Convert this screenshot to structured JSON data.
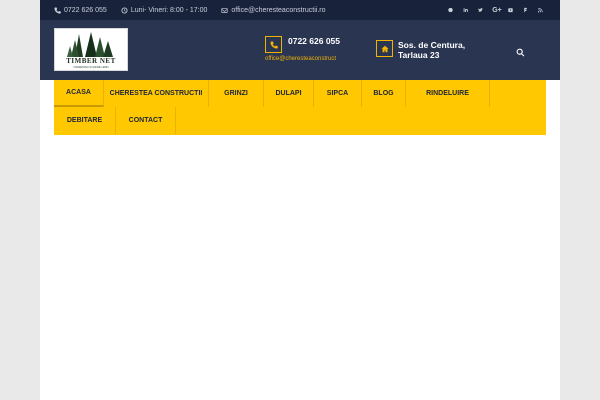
{
  "topbar": {
    "phone": "0722 626 055",
    "hours": "Luni- Vineri: 8:00 - 17:00",
    "email": "office@cheresteaconstructii.ro",
    "social_icons": [
      "facebook-icon",
      "linkedin-icon",
      "twitter-icon",
      "google-plus-icon",
      "youtube-icon",
      "foursquare-icon",
      "rss-icon"
    ]
  },
  "header": {
    "logo_text": "TIMBER NET",
    "logo_tagline": "CHERESTEA SI GRINZI LEMN",
    "phone": "0722 626 055",
    "email": "office@cheresteaconstruct",
    "address": "Sos. de Centura, Tarlaua 23"
  },
  "nav": {
    "items": [
      {
        "label": "ACASA"
      },
      {
        "label": "CHERESTEA CONSTRUCTII"
      },
      {
        "label": "GRINZI"
      },
      {
        "label": "DULAPI"
      },
      {
        "label": "SIPCA"
      },
      {
        "label": "BLOG"
      },
      {
        "label": "RINDELUIRE"
      },
      {
        "label": "DEBITARE"
      },
      {
        "label": "CONTACT"
      }
    ],
    "active": "ACASA"
  },
  "colors": {
    "topbar": "#18223a",
    "header": "#2a3552",
    "accent": "#ffc800",
    "icon_accent": "#f0b400"
  }
}
